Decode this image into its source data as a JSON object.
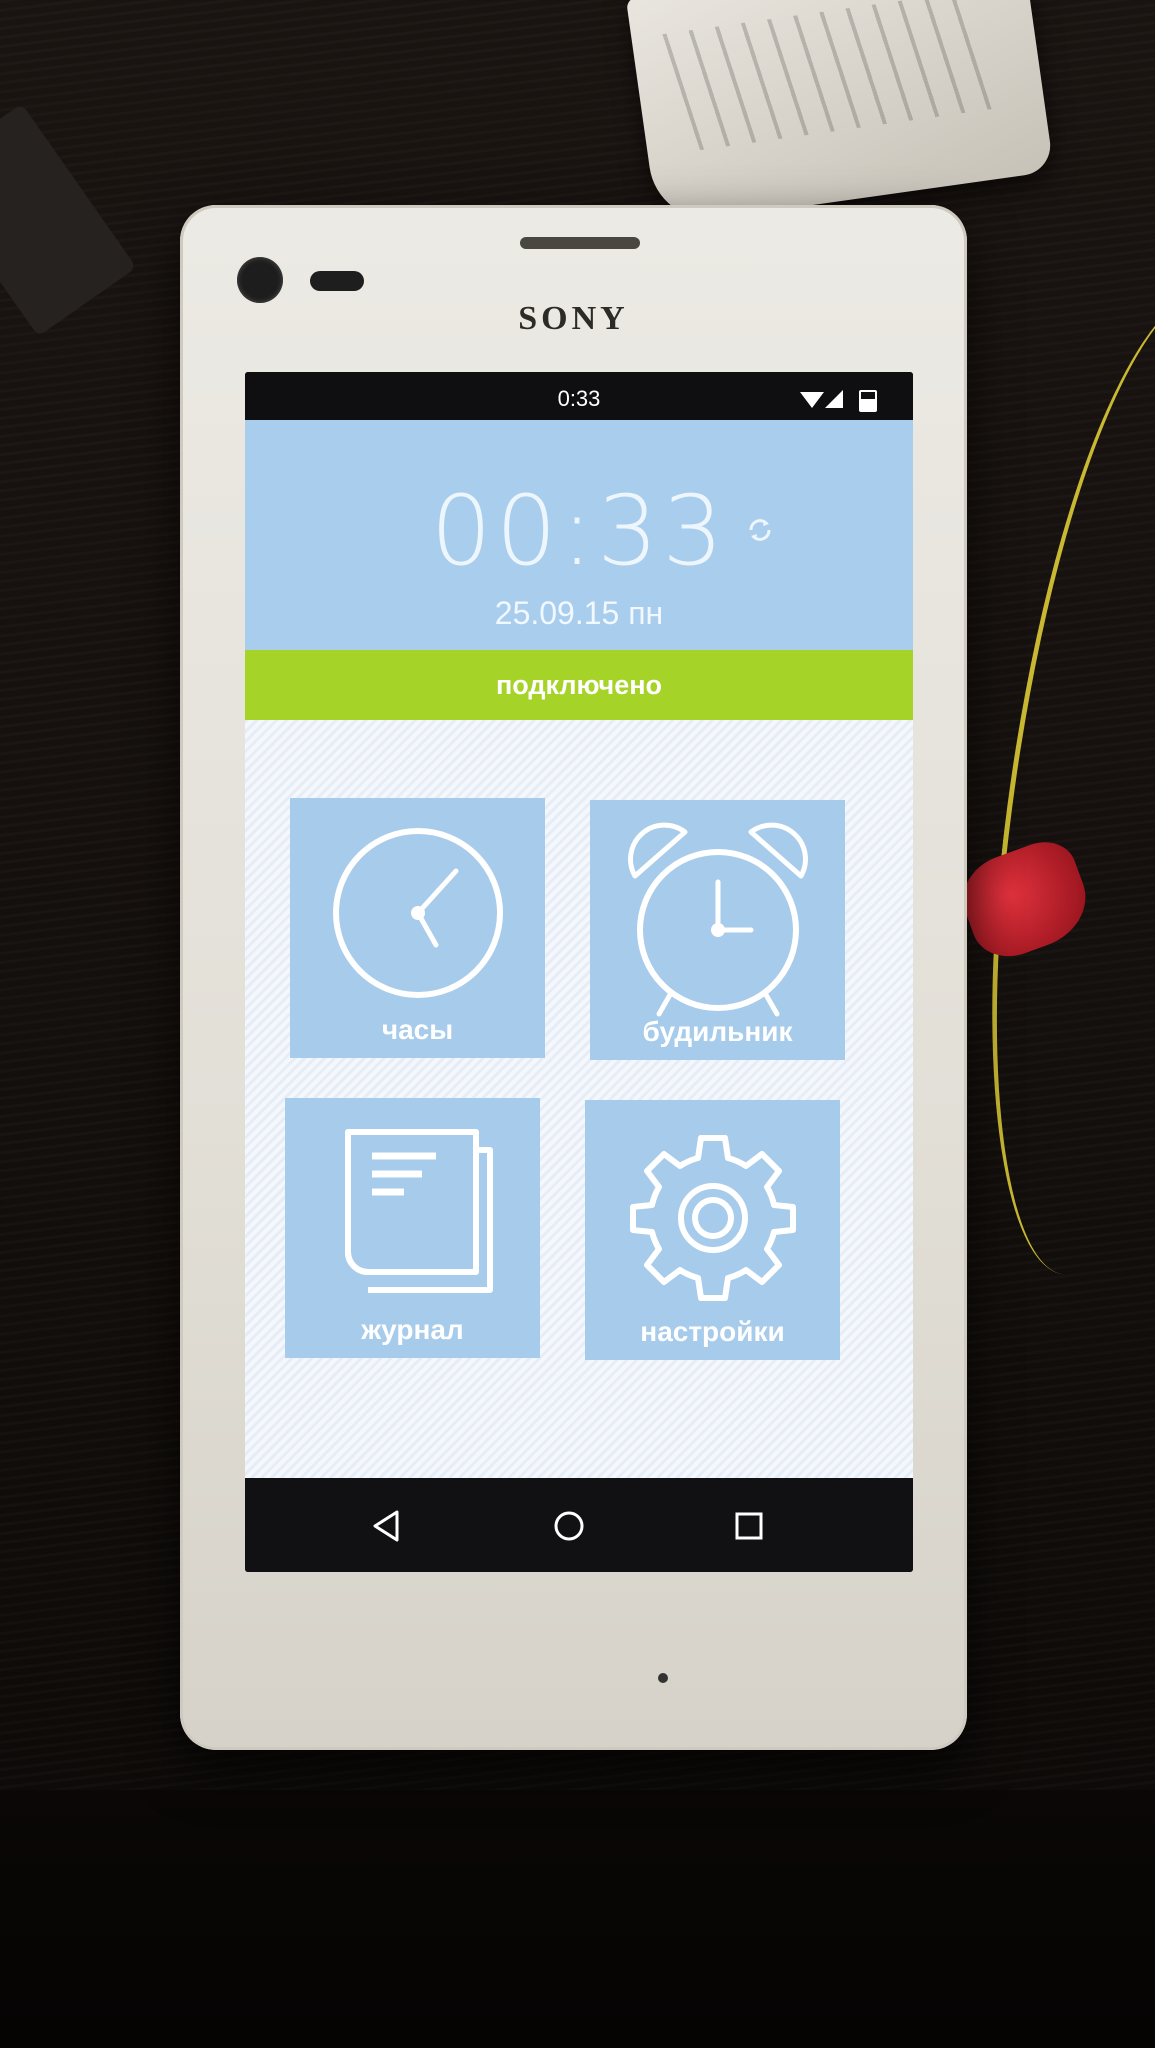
{
  "device": {
    "brand": "SONY"
  },
  "status_bar": {
    "time": "0:33"
  },
  "clock": {
    "time": "00:33",
    "date": "25.09.15 пн"
  },
  "connection": {
    "status": "подключено",
    "color": "#a5d327"
  },
  "tiles": [
    {
      "label": "часы",
      "icon": "clock-icon"
    },
    {
      "label": "будильник",
      "icon": "alarm-clock-icon"
    },
    {
      "label": "журнал",
      "icon": "journal-icon"
    },
    {
      "label": "настройки",
      "icon": "gear-icon"
    }
  ],
  "nav": {
    "back": "back-icon",
    "home": "home-icon",
    "recents": "recents-icon"
  },
  "colors": {
    "header": "#a9cdec",
    "tile": "#a7cbea"
  }
}
